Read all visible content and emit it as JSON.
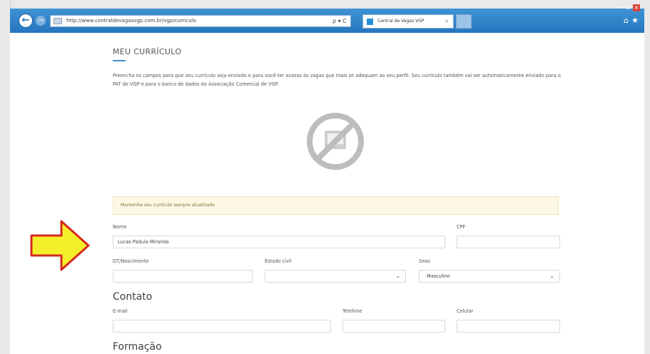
{
  "browser": {
    "address_url": "http://www.centraldevagasvgp.com.br/vgp/curriculo",
    "address_controls": "ρ ▾ C",
    "tab_label": "Central de Vagas VGP",
    "tab_close": "×"
  },
  "page": {
    "title": "MEU CURRÍCULO",
    "intro": "Preencha os campos para que seu currículo seja enviado e para você ter acesso às vagas que mais se adequam ao seu perfil. Seu currículo também vai ser automaticamente enviado para o PAT de VGP e para o banco de dados da Associação Comercial de VGP.",
    "notice": "Mantenha seu currículo sempre atualizado",
    "fields": {
      "nome": {
        "label": "Nome",
        "value": "Lucas Padula Miranda"
      },
      "cpf": {
        "label": "CPF",
        "value": ""
      },
      "nascimento": {
        "label": "DT/Nascimento",
        "value": ""
      },
      "estado_civil": {
        "label": "Estado civil",
        "value": ""
      },
      "sexo": {
        "label": "Sexo",
        "value": "Masculino"
      },
      "email": {
        "label": "E-mail",
        "value": ""
      },
      "telefone": {
        "label": "Telefone",
        "value": ""
      },
      "celular": {
        "label": "Celular",
        "value": ""
      }
    },
    "sections": {
      "contato": "Contato",
      "formacao": "Formação"
    }
  },
  "icons": {
    "no_photo": "no-photo-icon",
    "arrow": "yellow-arrow-pointer",
    "chevron": "chevron-down-icon"
  },
  "colors": {
    "browser_bar": "#2a7bc5",
    "accent": "#3c8fce",
    "notice_bg": "#fcf8e3",
    "arrow_fill": "#f5ee2a",
    "arrow_stroke": "#d42b1e"
  }
}
